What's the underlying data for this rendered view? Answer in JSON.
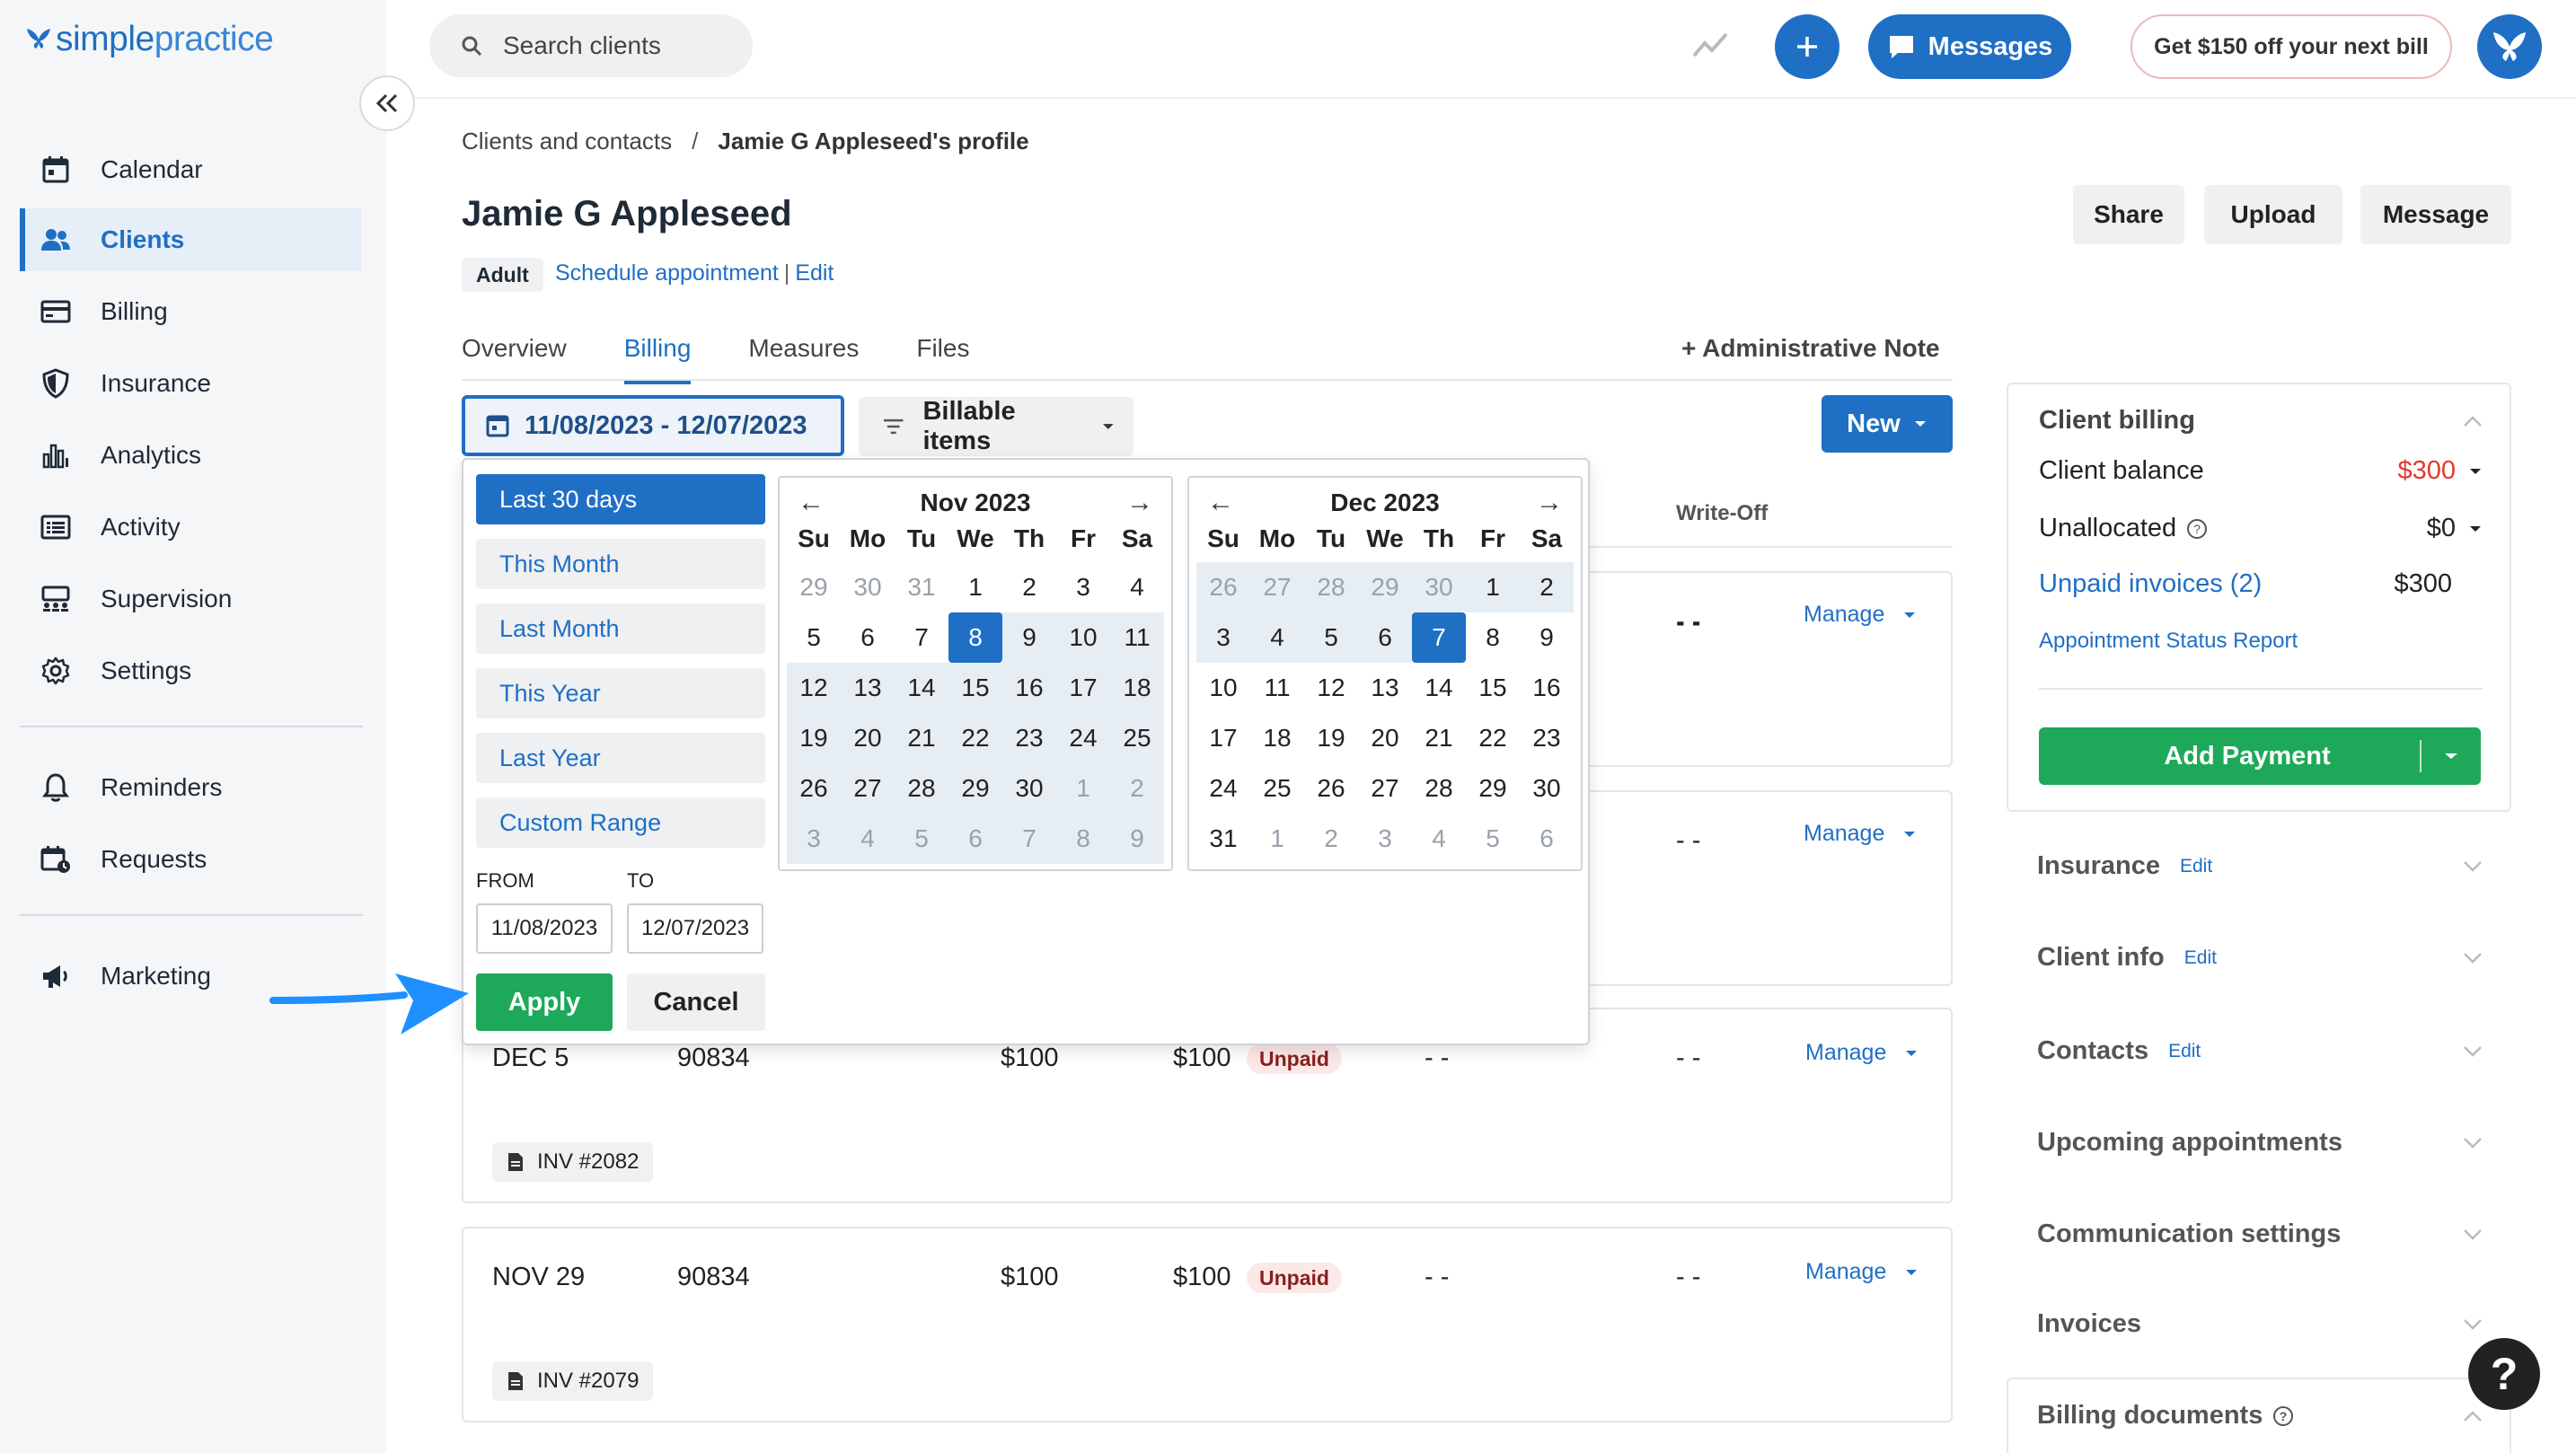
{
  "app": {
    "logo_prefix": "simple",
    "logo_suffix": "practice"
  },
  "sidebar": {
    "items": [
      {
        "label": "Calendar",
        "icon": "calendar-icon"
      },
      {
        "label": "Clients",
        "icon": "users-icon",
        "active": true
      },
      {
        "label": "Billing",
        "icon": "credit-card-icon"
      },
      {
        "label": "Insurance",
        "icon": "shield-icon"
      },
      {
        "label": "Analytics",
        "icon": "bar-chart-icon"
      },
      {
        "label": "Activity",
        "icon": "list-icon"
      },
      {
        "label": "Supervision",
        "icon": "supervision-icon"
      },
      {
        "label": "Settings",
        "icon": "gear-icon"
      },
      {
        "label": "Reminders",
        "icon": "bell-icon"
      },
      {
        "label": "Requests",
        "icon": "calendar-request-icon"
      },
      {
        "label": "Marketing",
        "icon": "megaphone-icon"
      }
    ]
  },
  "topbar": {
    "search_placeholder": "Search clients",
    "messages_label": "Messages",
    "promo_label": "Get $150 off your next bill"
  },
  "header": {
    "breadcrumb_parent": "Clients and contacts",
    "breadcrumb_sep": "/",
    "breadcrumb_current": "Jamie G Appleseed's profile",
    "client_name": "Jamie G Appleseed",
    "badge": "Adult",
    "schedule_link": "Schedule appointment",
    "edit_link": "Edit",
    "share_label": "Share",
    "upload_label": "Upload",
    "message_label": "Message"
  },
  "tabs": [
    {
      "label": "Overview"
    },
    {
      "label": "Billing",
      "active": true
    },
    {
      "label": "Measures"
    },
    {
      "label": "Files"
    }
  ],
  "admin_note": "+ Administrative Note",
  "toolbar": {
    "date_range": "11/08/2023 - 12/07/2023",
    "billable_items": "Billable items",
    "new_label": "New"
  },
  "table": {
    "writeoff_header": "Write-Off",
    "rows": [
      {
        "date": "",
        "code": "",
        "fee": "",
        "balance": "",
        "status": "",
        "insurance": "- -",
        "writeoff": "- -",
        "manage": "Manage"
      },
      {
        "date": "",
        "code": "",
        "fee": "",
        "balance": "",
        "status": "",
        "insurance": "",
        "writeoff": "- -",
        "manage": "Manage"
      },
      {
        "date": "DEC 5",
        "code": "90834",
        "fee": "$100",
        "balance": "$100",
        "status": "Unpaid",
        "insurance": "- -",
        "writeoff": "- -",
        "manage": "Manage",
        "invoice": "INV #2082"
      },
      {
        "date": "NOV 29",
        "code": "90834",
        "fee": "$100",
        "balance": "$100",
        "status": "Unpaid",
        "insurance": "- -",
        "writeoff": "- -",
        "manage": "Manage",
        "invoice": "INV #2079"
      }
    ]
  },
  "picker": {
    "presets": [
      {
        "label": "Last 30 days",
        "selected": true
      },
      {
        "label": "This Month"
      },
      {
        "label": "Last Month"
      },
      {
        "label": "This Year"
      },
      {
        "label": "Last Year"
      },
      {
        "label": "Custom Range"
      }
    ],
    "from_label": "FROM",
    "to_label": "TO",
    "from_value": "11/08/2023",
    "to_value": "12/07/2023",
    "apply_label": "Apply",
    "cancel_label": "Cancel",
    "dow": [
      "Su",
      "Mo",
      "Tu",
      "We",
      "Th",
      "Fr",
      "Sa"
    ],
    "left_month": "Nov 2023",
    "right_month": "Dec 2023",
    "left_weeks": [
      [
        "29",
        "30",
        "31",
        "1",
        "2",
        "3",
        "4"
      ],
      [
        "5",
        "6",
        "7",
        "8",
        "9",
        "10",
        "11"
      ],
      [
        "12",
        "13",
        "14",
        "15",
        "16",
        "17",
        "18"
      ],
      [
        "19",
        "20",
        "21",
        "22",
        "23",
        "24",
        "25"
      ],
      [
        "26",
        "27",
        "28",
        "29",
        "30",
        "1",
        "2"
      ],
      [
        "3",
        "4",
        "5",
        "6",
        "7",
        "8",
        "9"
      ]
    ],
    "right_weeks": [
      [
        "26",
        "27",
        "28",
        "29",
        "30",
        "1",
        "2"
      ],
      [
        "3",
        "4",
        "5",
        "6",
        "7",
        "8",
        "9"
      ],
      [
        "10",
        "11",
        "12",
        "13",
        "14",
        "15",
        "16"
      ],
      [
        "17",
        "18",
        "19",
        "20",
        "21",
        "22",
        "23"
      ],
      [
        "24",
        "25",
        "26",
        "27",
        "28",
        "29",
        "30"
      ],
      [
        "31",
        "1",
        "2",
        "3",
        "4",
        "5",
        "6"
      ]
    ]
  },
  "right_panel": {
    "title": "Client billing",
    "client_balance_label": "Client balance",
    "client_balance_value": "$300",
    "unallocated_label": "Unallocated",
    "unallocated_value": "$0",
    "unpaid_invoices_label": "Unpaid invoices (2)",
    "unpaid_invoices_value": "$300",
    "status_report_link": "Appointment Status Report",
    "add_payment_label": "Add Payment",
    "sections": [
      {
        "label": "Insurance",
        "edit": "Edit"
      },
      {
        "label": "Client info",
        "edit": "Edit"
      },
      {
        "label": "Contacts",
        "edit": "Edit"
      },
      {
        "label": "Upcoming appointments",
        "edit": ""
      },
      {
        "label": "Communication settings",
        "edit": ""
      },
      {
        "label": "Invoices",
        "edit": ""
      },
      {
        "label": "Billing documents",
        "edit": ""
      }
    ]
  },
  "colors": {
    "brand": "#1f6fc5",
    "success": "#1ea85a",
    "danger": "#e0392b"
  }
}
